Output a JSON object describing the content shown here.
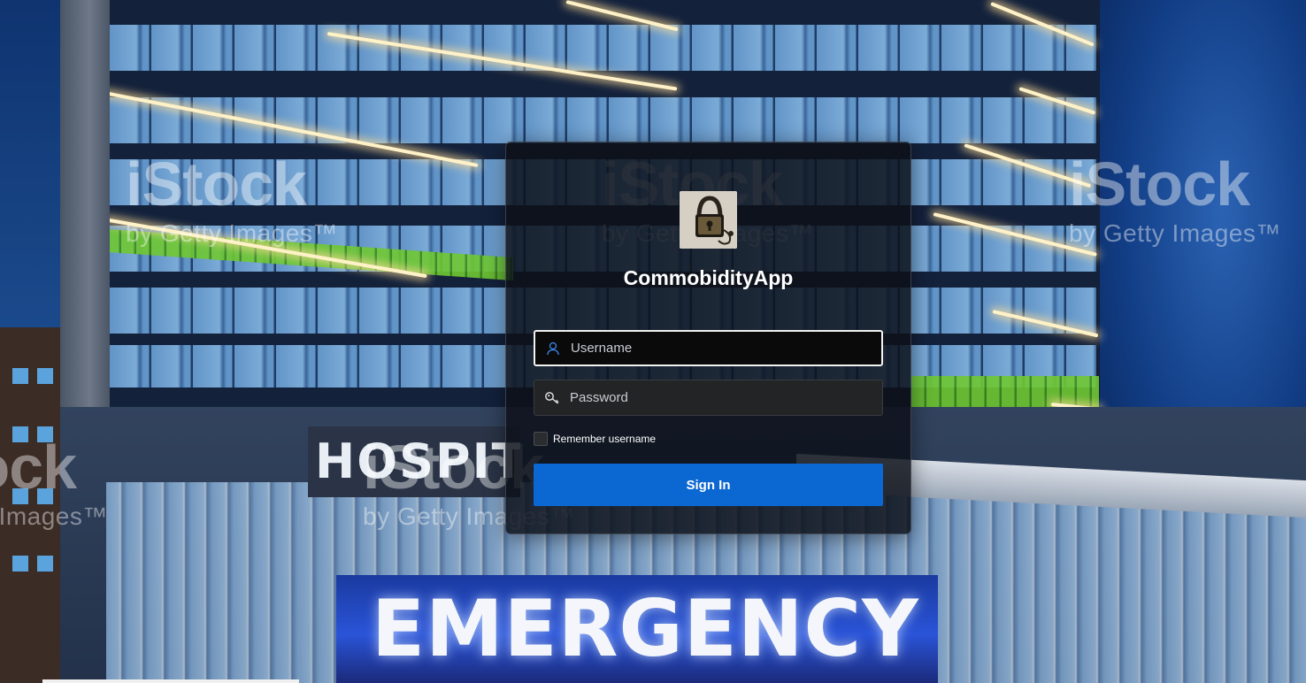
{
  "app": {
    "title": "CommobidityApp",
    "logo_icon": "padlock-photo-icon"
  },
  "form": {
    "username": {
      "placeholder": "Username",
      "value": "",
      "icon": "user-icon"
    },
    "password": {
      "placeholder": "Password",
      "value": "",
      "icon": "key-icon"
    },
    "remember": {
      "label": "Remember username",
      "checked": false
    },
    "submit_label": "Sign In"
  },
  "background": {
    "signs": {
      "hospital": "HOSPITAL",
      "emergency": "EMERGENCY"
    },
    "watermarks": [
      {
        "brand": "iStock",
        "tagline": "by Getty Images™"
      },
      {
        "brand": "iStock",
        "tagline": "by Getty Images™"
      },
      {
        "brand": "iStock",
        "tagline": "by Getty Images™"
      },
      {
        "brand": "iStock",
        "tagline": "by Getty Images™"
      },
      {
        "brand": "iStock",
        "tagline": "by Getty Images™"
      }
    ]
  },
  "colors": {
    "accent": "#0b67d1",
    "card_bg": "#0c1018",
    "focus_border": "#f2f2f2",
    "user_icon": "#3d86e6"
  }
}
